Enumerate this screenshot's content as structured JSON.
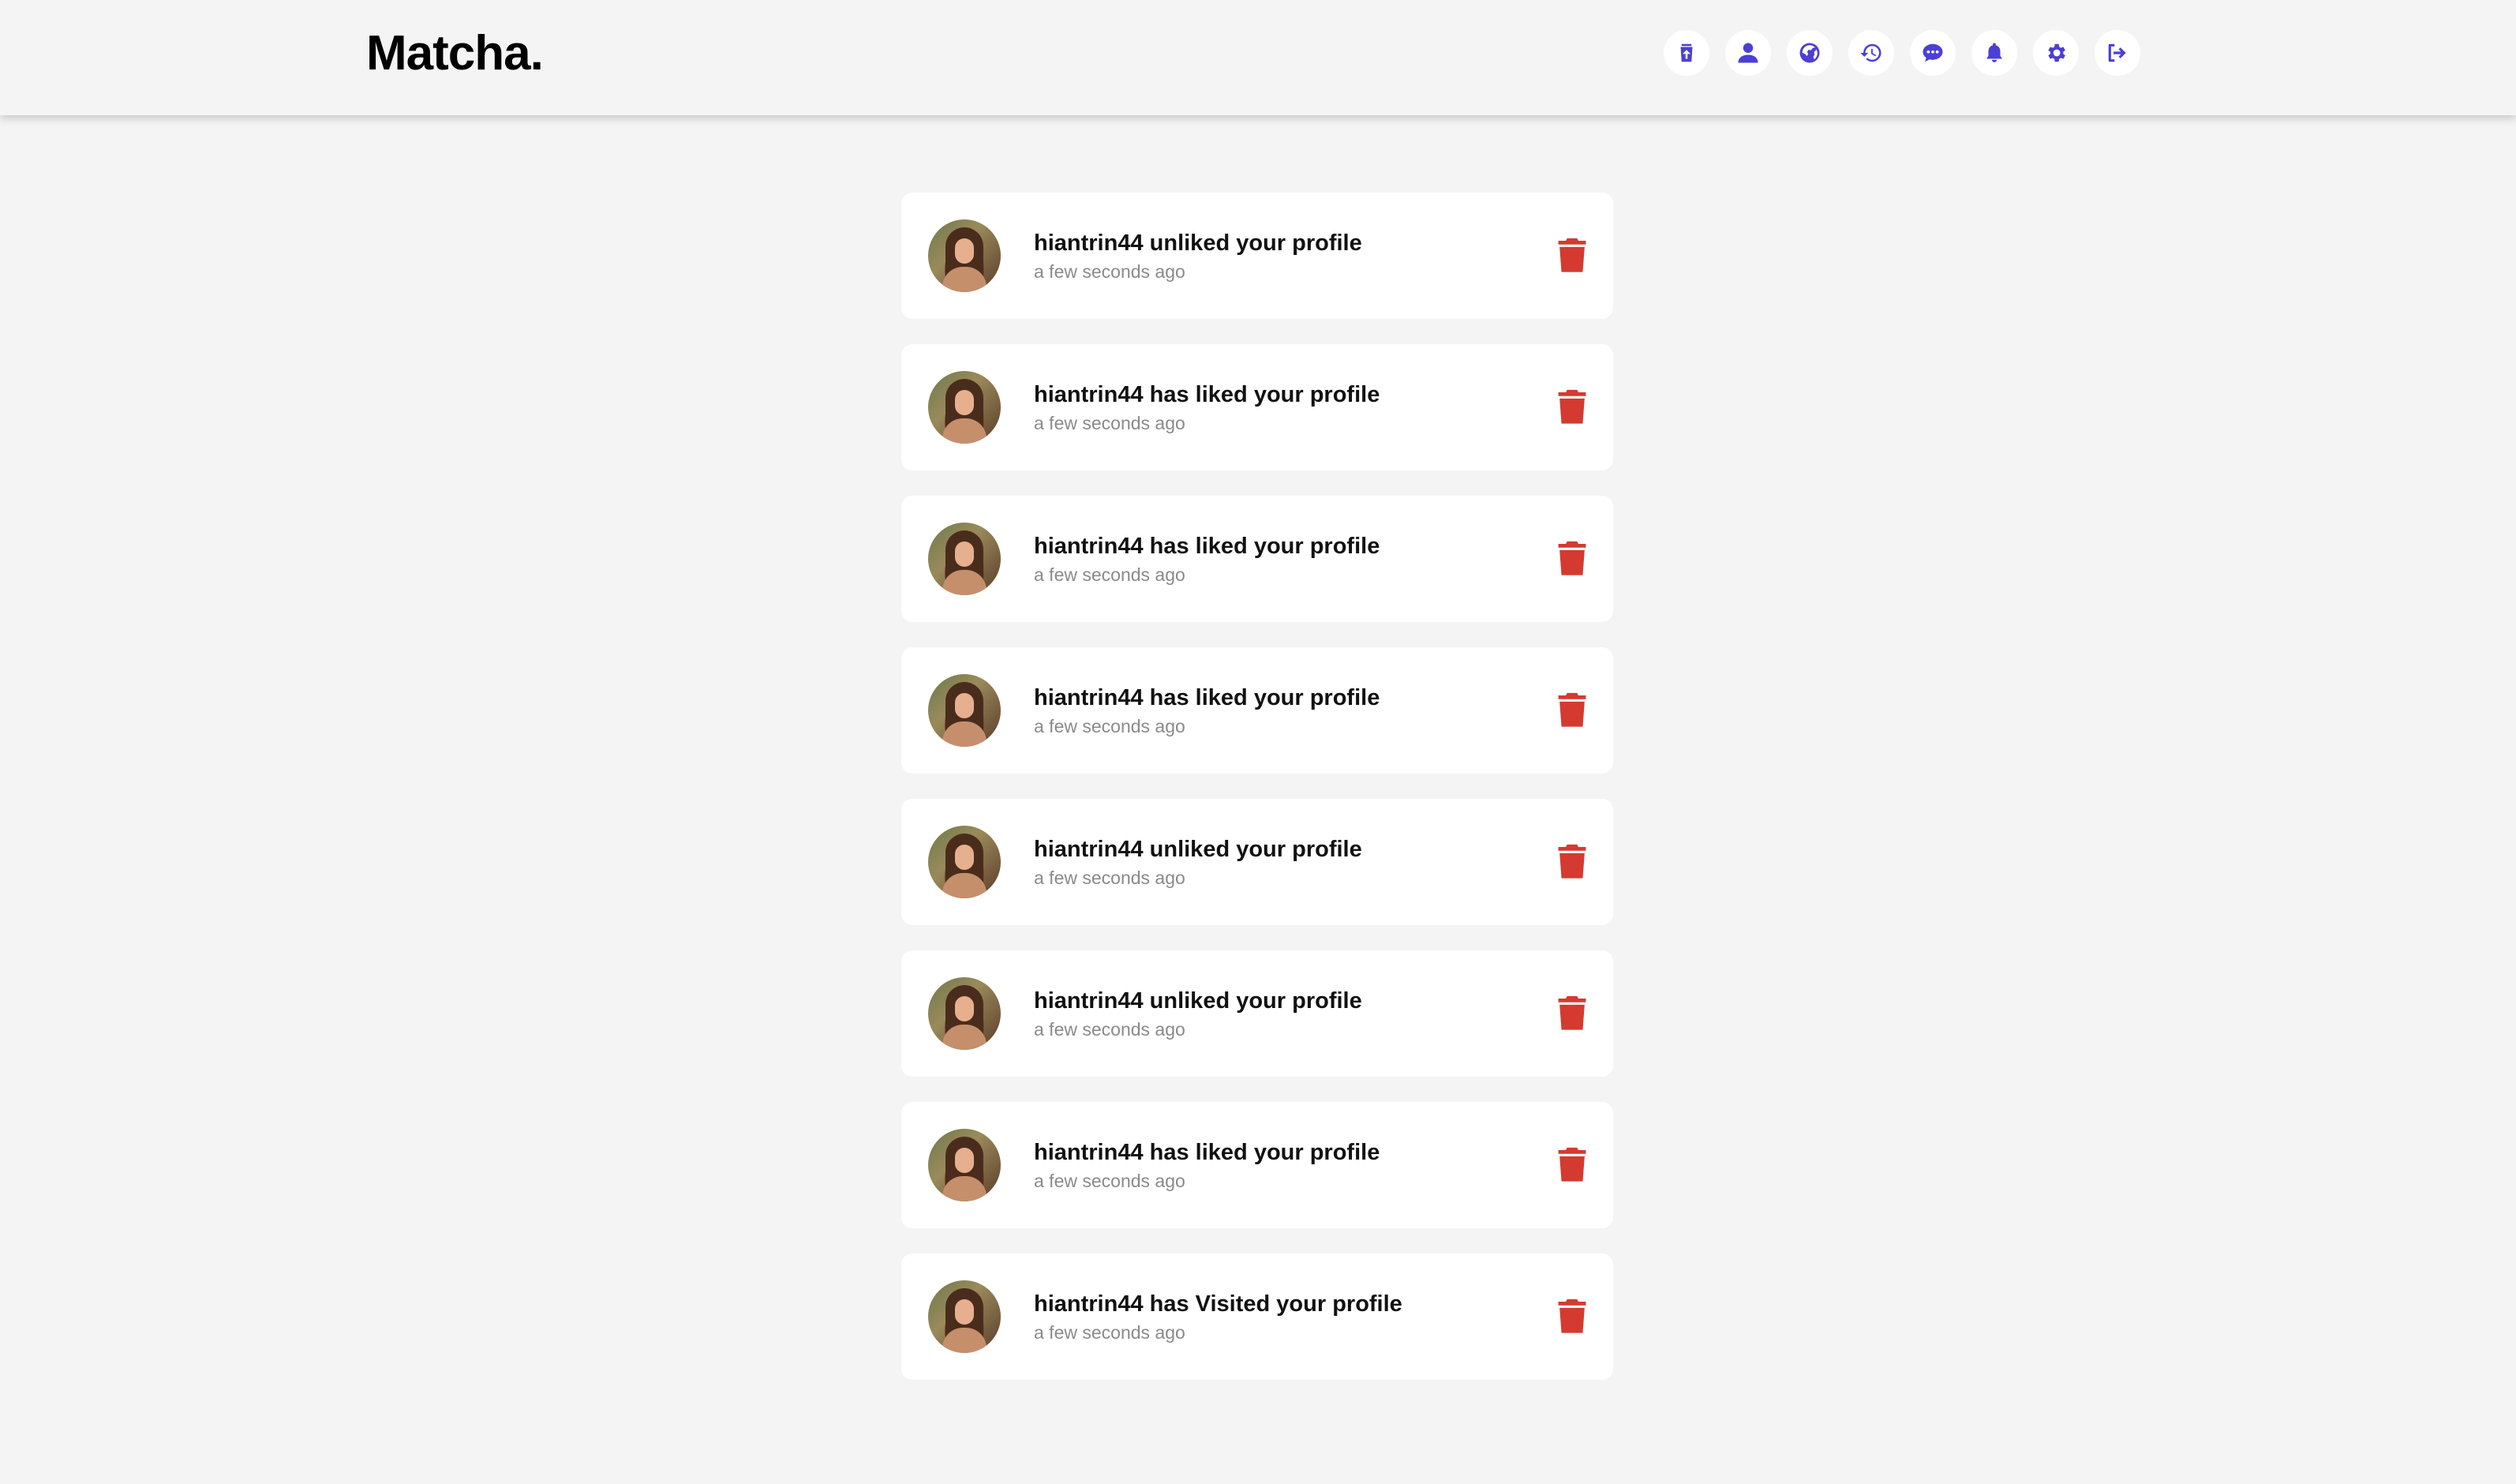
{
  "header": {
    "brand": "Matcha.",
    "nav": [
      {
        "name": "upload-icon"
      },
      {
        "name": "profile-icon"
      },
      {
        "name": "explore-icon"
      },
      {
        "name": "history-icon"
      },
      {
        "name": "chat-icon"
      },
      {
        "name": "notifications-icon"
      },
      {
        "name": "settings-icon"
      },
      {
        "name": "logout-icon"
      }
    ]
  },
  "colors": {
    "accent": "#4b3fd6",
    "delete": "#d43a2f",
    "background": "#f4f4f4"
  },
  "notifications": [
    {
      "message": "hiantrin44 unliked your profile",
      "time": "a few seconds ago"
    },
    {
      "message": "hiantrin44 has liked your profile",
      "time": "a few seconds ago"
    },
    {
      "message": "hiantrin44 has liked your profile",
      "time": "a few seconds ago"
    },
    {
      "message": "hiantrin44 has liked your profile",
      "time": "a few seconds ago"
    },
    {
      "message": "hiantrin44 unliked your profile",
      "time": "a few seconds ago"
    },
    {
      "message": "hiantrin44 unliked your profile",
      "time": "a few seconds ago"
    },
    {
      "message": "hiantrin44 has liked your profile",
      "time": "a few seconds ago"
    },
    {
      "message": "hiantrin44 has Visited your profile",
      "time": "a few seconds ago"
    }
  ]
}
